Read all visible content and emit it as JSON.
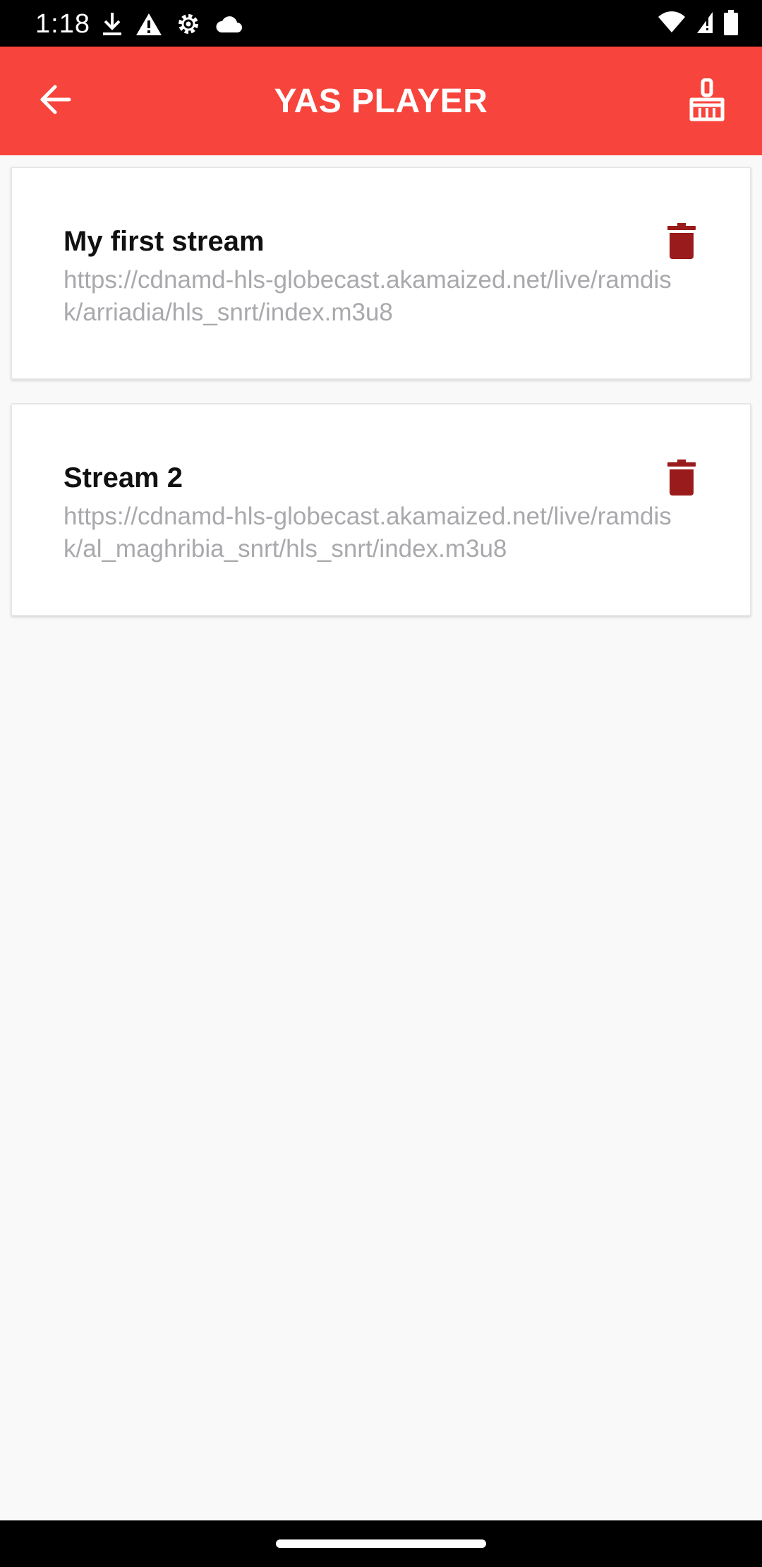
{
  "status_bar": {
    "time": "1:18",
    "left_icons": [
      "download-icon",
      "warning-icon",
      "gear-icon",
      "cloud-icon"
    ],
    "right_icons": [
      "wifi-icon",
      "signal-icon",
      "battery-icon"
    ]
  },
  "app_bar": {
    "title": "YAS PLAYER",
    "back_icon": "arrow-left-icon",
    "action_icon": "broom-icon",
    "color": "#f7443c"
  },
  "streams": [
    {
      "name": "My first stream",
      "url": "https://cdnamd-hls-globecast.akamaized.net/live/ramdisk/arriadia/hls_snrt/index.m3u8"
    },
    {
      "name": "Stream 2",
      "url": "https://cdnamd-hls-globecast.akamaized.net/live/ramdisk/al_maghribia_snrt/hls_snrt/index.m3u8"
    }
  ],
  "colors": {
    "delete_icon": "#9a1b1b",
    "url_text": "#a9a9ad",
    "background": "#f9f9fa"
  }
}
